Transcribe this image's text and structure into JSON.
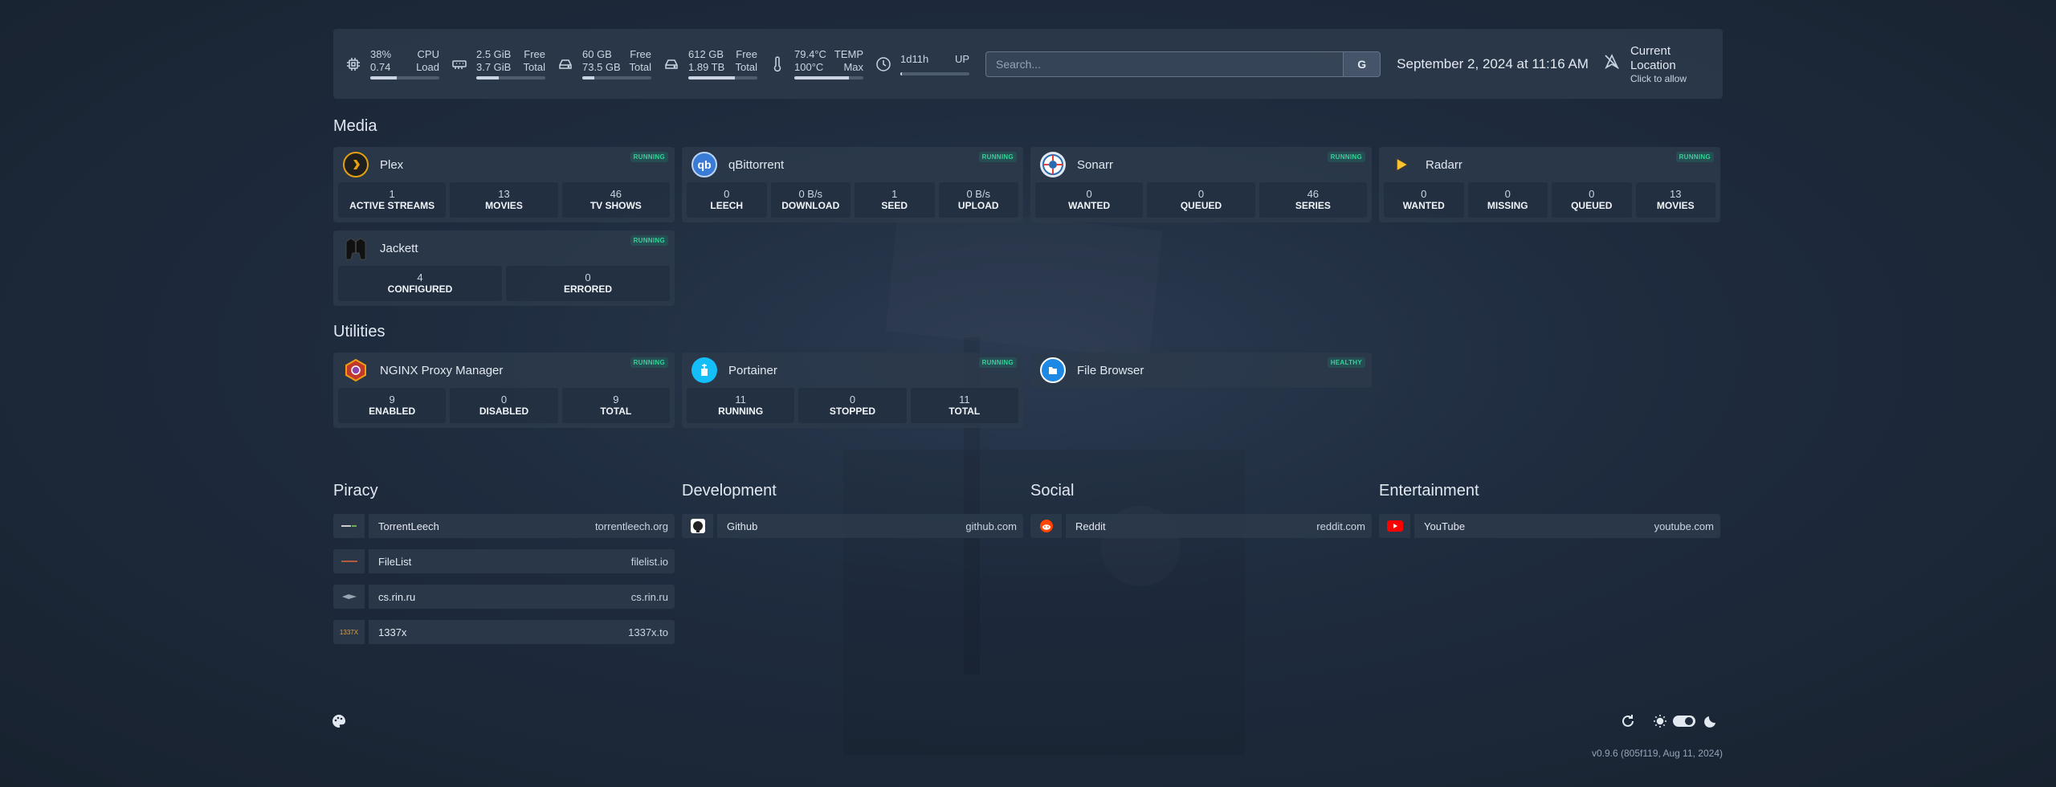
{
  "widgets": {
    "cpu": {
      "icon": "cpu-icon",
      "usage": "38%",
      "label1": "CPU",
      "load": "0.74",
      "label2": "Load",
      "fraction": 0.38
    },
    "memory": {
      "icon": "memory-icon",
      "free": "2.5 GiB",
      "label1": "Free",
      "total": "3.7 GiB",
      "label2": "Total",
      "fraction": 0.32
    },
    "disk1": {
      "icon": "disk-icon",
      "free": "60 GB",
      "label1": "Free",
      "total": "73.5 GB",
      "label2": "Total",
      "fraction": 0.18
    },
    "disk2": {
      "icon": "disk-icon",
      "free": "612 GB",
      "label1": "Free",
      "total": "1.89 TB",
      "label2": "Total",
      "fraction": 0.68
    },
    "temp": {
      "icon": "thermometer-icon",
      "current": "79.4°C",
      "label1": "TEMP",
      "max": "100°C",
      "label2": "Max",
      "fraction": 0.79
    },
    "uptime": {
      "icon": "clock-icon",
      "value": "1d11h",
      "label": "UP",
      "fraction": 0.02
    }
  },
  "search": {
    "placeholder": "Search...",
    "engine_label": "G"
  },
  "datetime": "September 2, 2024 at 11:16 AM",
  "location": {
    "title": "Current Location",
    "subtitle": "Click to allow"
  },
  "sections": {
    "media": "Media",
    "utilities": "Utilities",
    "piracy": "Piracy",
    "development": "Development",
    "social": "Social",
    "entertainment": "Entertainment"
  },
  "media": {
    "plex": {
      "name": "Plex",
      "status": "RUNNING",
      "stats": [
        {
          "v": "1",
          "l": "ACTIVE STREAMS"
        },
        {
          "v": "13",
          "l": "MOVIES"
        },
        {
          "v": "46",
          "l": "TV SHOWS"
        }
      ]
    },
    "qbittorrent": {
      "name": "qBittorrent",
      "status": "RUNNING",
      "logo_text": "qb",
      "stats": [
        {
          "v": "0",
          "l": "LEECH"
        },
        {
          "v": "0 B/s",
          "l": "DOWNLOAD"
        },
        {
          "v": "1",
          "l": "SEED"
        },
        {
          "v": "0 B/s",
          "l": "UPLOAD"
        }
      ]
    },
    "sonarr": {
      "name": "Sonarr",
      "status": "RUNNING",
      "stats": [
        {
          "v": "0",
          "l": "WANTED"
        },
        {
          "v": "0",
          "l": "QUEUED"
        },
        {
          "v": "46",
          "l": "SERIES"
        }
      ]
    },
    "radarr": {
      "name": "Radarr",
      "status": "RUNNING",
      "stats": [
        {
          "v": "0",
          "l": "WANTED"
        },
        {
          "v": "0",
          "l": "MISSING"
        },
        {
          "v": "0",
          "l": "QUEUED"
        },
        {
          "v": "13",
          "l": "MOVIES"
        }
      ]
    },
    "jackett": {
      "name": "Jackett",
      "status": "RUNNING",
      "stats": [
        {
          "v": "4",
          "l": "CONFIGURED"
        },
        {
          "v": "0",
          "l": "ERRORED"
        }
      ]
    }
  },
  "utilities": {
    "npm": {
      "name": "NGINX Proxy Manager",
      "status": "RUNNING",
      "stats": [
        {
          "v": "9",
          "l": "ENABLED"
        },
        {
          "v": "0",
          "l": "DISABLED"
        },
        {
          "v": "9",
          "l": "TOTAL"
        }
      ]
    },
    "portainer": {
      "name": "Portainer",
      "status": "RUNNING",
      "stats": [
        {
          "v": "11",
          "l": "RUNNING"
        },
        {
          "v": "0",
          "l": "STOPPED"
        },
        {
          "v": "11",
          "l": "TOTAL"
        }
      ]
    },
    "filebrowser": {
      "name": "File Browser",
      "status": "HEALTHY"
    }
  },
  "bookmarks": {
    "piracy": [
      {
        "name": "TorrentLeech",
        "url": "torrentleech.org"
      },
      {
        "name": "FileList",
        "url": "filelist.io"
      },
      {
        "name": "cs.rin.ru",
        "url": "cs.rin.ru"
      },
      {
        "name": "1337x",
        "url": "1337x.to",
        "icon_text": "1337X"
      }
    ],
    "development": [
      {
        "name": "Github",
        "url": "github.com"
      }
    ],
    "social": [
      {
        "name": "Reddit",
        "url": "reddit.com"
      }
    ],
    "entertainment": [
      {
        "name": "YouTube",
        "url": "youtube.com"
      }
    ]
  },
  "footer": {
    "version": "v0.9.6 (805f119, Aug 11, 2024)"
  },
  "colors": {
    "running": "#34d399",
    "card": "#2c394b",
    "background": "#1f2c3f"
  }
}
